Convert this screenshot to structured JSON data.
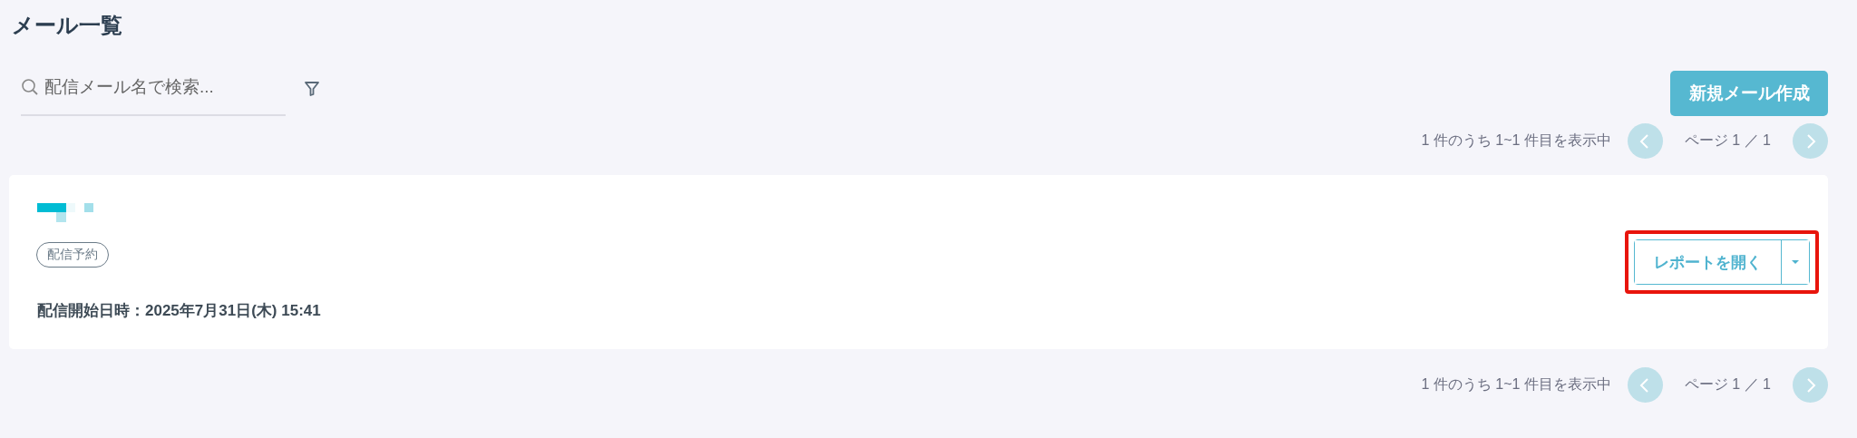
{
  "page_title": "メール一覧",
  "search": {
    "placeholder": "配信メール名で検索..."
  },
  "new_button": "新規メール作成",
  "pagination_top": {
    "summary": "1 件のうち 1~1 件目を表示中",
    "page": "ページ 1 ／ 1",
    "prev_disabled": true,
    "next_disabled": true
  },
  "mails": [
    {
      "status": "配信予約",
      "start": "配信開始日時：2025年7月31日(木) 15:41",
      "action": "レポートを開く",
      "highlighted": true
    }
  ],
  "pagination_bottom": {
    "summary": "1 件のうち 1~1 件目を表示中",
    "page": "ページ 1 ／ 1",
    "prev_disabled": true,
    "next_disabled": true
  }
}
